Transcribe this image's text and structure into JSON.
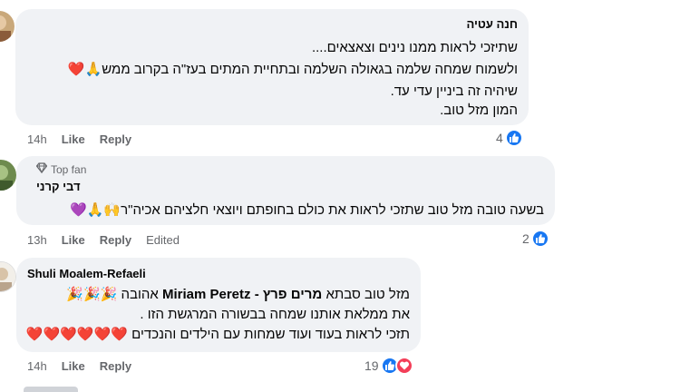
{
  "comments": [
    {
      "author": "חנה עטיה",
      "lines": [
        "שתיזכי לראות ממנו נינים וצאצאים....",
        "ולשמוח שמחה שלמה בגאולה השלמה ובתחיית המתים בעז\"ה בקרוב ממש🙏❤️",
        "שיהיה זה ביניין עדי עד.",
        "המון מזל טוב."
      ],
      "time": "14h",
      "like_label": "Like",
      "reply_label": "Reply",
      "reaction_count": "4"
    },
    {
      "badge": "Top fan",
      "author": "דבי קרני",
      "lines": [
        "בשעה טובה מזל טוב שתזכי לראות את כולם בחופתם ויוצאי חלציהם אכיה\"ר🙌🙏💜"
      ],
      "time": "13h",
      "like_label": "Like",
      "reply_label": "Reply",
      "edited_label": "Edited",
      "reaction_count": "2"
    },
    {
      "author": "Shuli Moalem-Refaeli",
      "line1_pre": "מזל טוב סבתא ",
      "mention": "מרים פרץ - Miriam Peretz",
      "line1_post": " אהובה 🎉🎉🎉",
      "lines": [
        "את ממלאת אותנו שמחה בבשורה המרגשת הזו .",
        "תזכי לראות בעוד ועוד שמחות עם הילדים והנכדים ❤️❤️❤️❤️❤️❤️"
      ],
      "time": "14h",
      "like_label": "Like",
      "reply_label": "Reply",
      "reaction_count": "19"
    }
  ],
  "icons": {
    "like": "like-reaction-icon",
    "love": "love-reaction-icon",
    "top_fan": "diamond-icon"
  },
  "colors": {
    "like": "#1877f2",
    "love": "#f33e58",
    "bubble": "#f0f2f5",
    "meta": "#65676b"
  }
}
